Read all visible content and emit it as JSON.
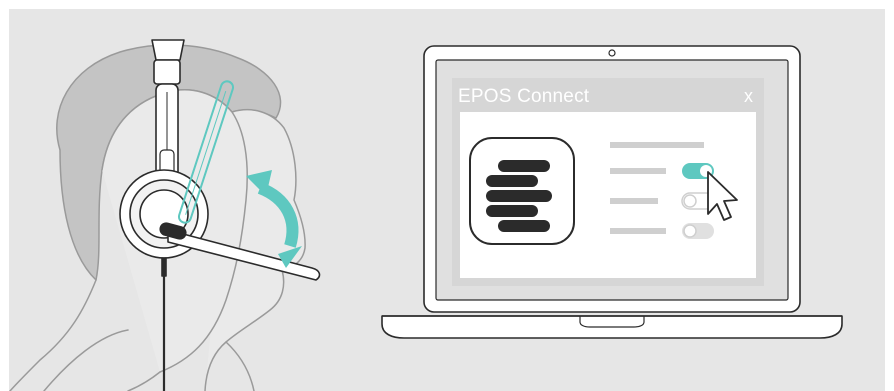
{
  "app": {
    "title": "EPOS Connect",
    "close_label": "x"
  },
  "toggles": [
    {
      "state": "on"
    },
    {
      "state": "off"
    },
    {
      "state": "off"
    }
  ],
  "colors": {
    "accent": "#5ec8c0",
    "background": "#e6e6e6",
    "line": "#2b2b2b",
    "window_frame": "#d9d9d9",
    "muted_bar": "#cfcfcf"
  },
  "icons": [
    "epos-logo-icon",
    "mouse-cursor-icon",
    "adjust-arrow-icon",
    "camera-icon"
  ]
}
